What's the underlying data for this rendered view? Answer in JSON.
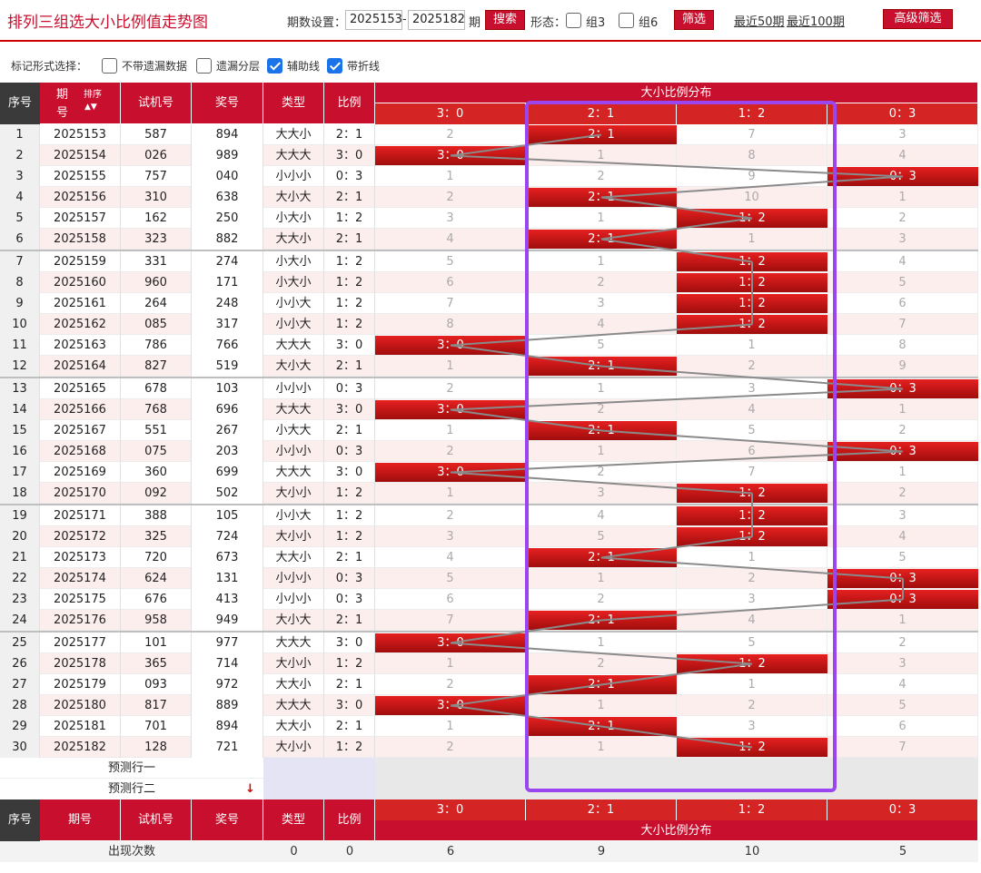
{
  "header": {
    "title": "排列三组选大小比例值走势图",
    "period_label": "期数设置：",
    "period_from": "2025153",
    "period_dash": "-",
    "period_to": "2025182",
    "period_suffix": "期",
    "search_label": "搜索",
    "form_label": "形态：",
    "group3_label": "组3",
    "group6_label": "组6",
    "filter_label": "筛选",
    "recent50": "最近50期",
    "recent100": "最近100期",
    "advanced": "高级筛选"
  },
  "options": {
    "label": "标记形式选择：",
    "items": [
      {
        "label": "不带遗漏数据",
        "checked": false
      },
      {
        "label": "遗漏分层",
        "checked": false
      },
      {
        "label": "辅助线",
        "checked": true
      },
      {
        "label": "带折线",
        "checked": true
      }
    ]
  },
  "table": {
    "headers": {
      "seq": "序号",
      "period_a": "期",
      "period_b": "号",
      "sort": "排序",
      "trial": "试机号",
      "draw": "奖号",
      "type": "类型",
      "ratio": "比例",
      "dist": "大小比例分布",
      "period_full": "期号"
    },
    "ratios": [
      "3：0",
      "2：1",
      "1：2",
      "0：3"
    ],
    "rows": [
      {
        "seq": "1",
        "period": "2025153",
        "trial": "587",
        "draw": "894",
        "type": "大大小",
        "ratio": "2：1",
        "dist": [
          "2",
          "2：1",
          "7",
          "3"
        ]
      },
      {
        "seq": "2",
        "period": "2025154",
        "trial": "026",
        "draw": "989",
        "type": "大大大",
        "ratio": "3：0",
        "dist": [
          "3：0",
          "1",
          "8",
          "4"
        ]
      },
      {
        "seq": "3",
        "period": "2025155",
        "trial": "757",
        "draw": "040",
        "type": "小小小",
        "ratio": "0：3",
        "dist": [
          "1",
          "2",
          "9",
          "0：3"
        ]
      },
      {
        "seq": "4",
        "period": "2025156",
        "trial": "310",
        "draw": "638",
        "type": "大小大",
        "ratio": "2：1",
        "dist": [
          "2",
          "2：1",
          "10",
          "1"
        ]
      },
      {
        "seq": "5",
        "period": "2025157",
        "trial": "162",
        "draw": "250",
        "type": "小大小",
        "ratio": "1：2",
        "dist": [
          "3",
          "1",
          "1：2",
          "2"
        ]
      },
      {
        "seq": "6",
        "period": "2025158",
        "trial": "323",
        "draw": "882",
        "type": "大大小",
        "ratio": "2：1",
        "dist": [
          "4",
          "2：1",
          "1",
          "3"
        ]
      },
      {
        "seq": "7",
        "period": "2025159",
        "trial": "331",
        "draw": "274",
        "type": "小大小",
        "ratio": "1：2",
        "dist": [
          "5",
          "1",
          "1：2",
          "4"
        ]
      },
      {
        "seq": "8",
        "period": "2025160",
        "trial": "960",
        "draw": "171",
        "type": "小大小",
        "ratio": "1：2",
        "dist": [
          "6",
          "2",
          "1：2",
          "5"
        ]
      },
      {
        "seq": "9",
        "period": "2025161",
        "trial": "264",
        "draw": "248",
        "type": "小小大",
        "ratio": "1：2",
        "dist": [
          "7",
          "3",
          "1：2",
          "6"
        ]
      },
      {
        "seq": "10",
        "period": "2025162",
        "trial": "085",
        "draw": "317",
        "type": "小小大",
        "ratio": "1：2",
        "dist": [
          "8",
          "4",
          "1：2",
          "7"
        ]
      },
      {
        "seq": "11",
        "period": "2025163",
        "trial": "786",
        "draw": "766",
        "type": "大大大",
        "ratio": "3：0",
        "dist": [
          "3：0",
          "5",
          "1",
          "8"
        ]
      },
      {
        "seq": "12",
        "period": "2025164",
        "trial": "827",
        "draw": "519",
        "type": "大小大",
        "ratio": "2：1",
        "dist": [
          "1",
          "2：1",
          "2",
          "9"
        ]
      },
      {
        "seq": "13",
        "period": "2025165",
        "trial": "678",
        "draw": "103",
        "type": "小小小",
        "ratio": "0：3",
        "dist": [
          "2",
          "1",
          "3",
          "0：3"
        ]
      },
      {
        "seq": "14",
        "period": "2025166",
        "trial": "768",
        "draw": "696",
        "type": "大大大",
        "ratio": "3：0",
        "dist": [
          "3：0",
          "2",
          "4",
          "1"
        ]
      },
      {
        "seq": "15",
        "period": "2025167",
        "trial": "551",
        "draw": "267",
        "type": "小大大",
        "ratio": "2：1",
        "dist": [
          "1",
          "2：1",
          "5",
          "2"
        ]
      },
      {
        "seq": "16",
        "period": "2025168",
        "trial": "075",
        "draw": "203",
        "type": "小小小",
        "ratio": "0：3",
        "dist": [
          "2",
          "1",
          "6",
          "0：3"
        ]
      },
      {
        "seq": "17",
        "period": "2025169",
        "trial": "360",
        "draw": "699",
        "type": "大大大",
        "ratio": "3：0",
        "dist": [
          "3：0",
          "2",
          "7",
          "1"
        ]
      },
      {
        "seq": "18",
        "period": "2025170",
        "trial": "092",
        "draw": "502",
        "type": "大小小",
        "ratio": "1：2",
        "dist": [
          "1",
          "3",
          "1：2",
          "2"
        ]
      },
      {
        "seq": "19",
        "period": "2025171",
        "trial": "388",
        "draw": "105",
        "type": "小小大",
        "ratio": "1：2",
        "dist": [
          "2",
          "4",
          "1：2",
          "3"
        ]
      },
      {
        "seq": "20",
        "period": "2025172",
        "trial": "325",
        "draw": "724",
        "type": "大小小",
        "ratio": "1：2",
        "dist": [
          "3",
          "5",
          "1：2",
          "4"
        ]
      },
      {
        "seq": "21",
        "period": "2025173",
        "trial": "720",
        "draw": "673",
        "type": "大大小",
        "ratio": "2：1",
        "dist": [
          "4",
          "2：1",
          "1",
          "5"
        ]
      },
      {
        "seq": "22",
        "period": "2025174",
        "trial": "624",
        "draw": "131",
        "type": "小小小",
        "ratio": "0：3",
        "dist": [
          "5",
          "1",
          "2",
          "0：3"
        ]
      },
      {
        "seq": "23",
        "period": "2025175",
        "trial": "676",
        "draw": "413",
        "type": "小小小",
        "ratio": "0：3",
        "dist": [
          "6",
          "2",
          "3",
          "0：3"
        ]
      },
      {
        "seq": "24",
        "period": "2025176",
        "trial": "958",
        "draw": "949",
        "type": "大小大",
        "ratio": "2：1",
        "dist": [
          "7",
          "2：1",
          "4",
          "1"
        ]
      },
      {
        "seq": "25",
        "period": "2025177",
        "trial": "101",
        "draw": "977",
        "type": "大大大",
        "ratio": "3：0",
        "dist": [
          "3：0",
          "1",
          "5",
          "2"
        ]
      },
      {
        "seq": "26",
        "period": "2025178",
        "trial": "365",
        "draw": "714",
        "type": "大小小",
        "ratio": "1：2",
        "dist": [
          "1",
          "2",
          "1：2",
          "3"
        ]
      },
      {
        "seq": "27",
        "period": "2025179",
        "trial": "093",
        "draw": "972",
        "type": "大大小",
        "ratio": "2：1",
        "dist": [
          "2",
          "2：1",
          "1",
          "4"
        ]
      },
      {
        "seq": "28",
        "period": "2025180",
        "trial": "817",
        "draw": "889",
        "type": "大大大",
        "ratio": "3：0",
        "dist": [
          "3：0",
          "1",
          "2",
          "5"
        ]
      },
      {
        "seq": "29",
        "period": "2025181",
        "trial": "701",
        "draw": "894",
        "type": "大大小",
        "ratio": "2：1",
        "dist": [
          "1",
          "2：1",
          "3",
          "6"
        ]
      },
      {
        "seq": "30",
        "period": "2025182",
        "trial": "128",
        "draw": "721",
        "type": "大小小",
        "ratio": "1：2",
        "dist": [
          "2",
          "1",
          "1：2",
          "7"
        ]
      }
    ],
    "hit_columns": [
      1,
      0,
      3,
      1,
      2,
      1,
      2,
      2,
      2,
      2,
      0,
      1,
      3,
      0,
      1,
      3,
      0,
      2,
      2,
      2,
      1,
      3,
      3,
      1,
      0,
      2,
      1,
      0,
      1,
      2
    ],
    "predict1": "预测行一",
    "predict2": "预测行二",
    "stats": {
      "label": "出现次数",
      "type": "0",
      "ratio": "0",
      "dist": [
        "6",
        "9",
        "10",
        "5"
      ]
    }
  },
  "colors": {
    "accent": "#c8102e",
    "highlight": "#9b45f0",
    "odd_row": "#fdeeee"
  }
}
